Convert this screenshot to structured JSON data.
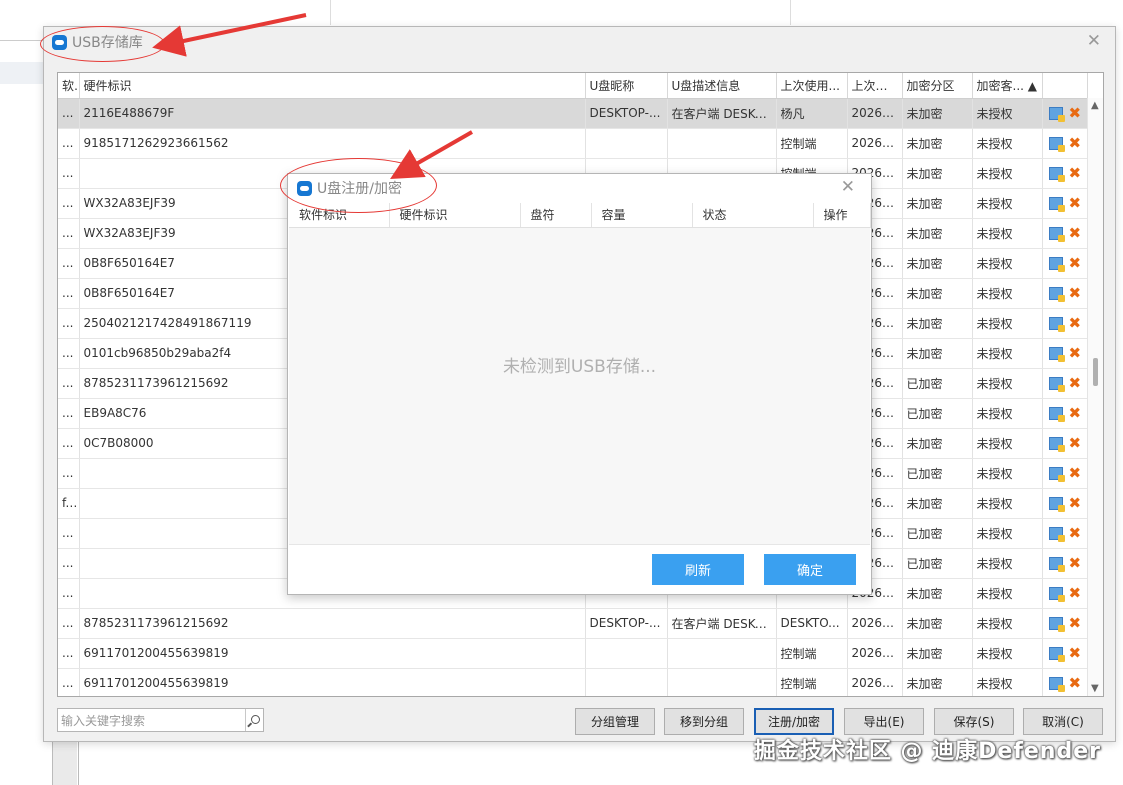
{
  "main_window": {
    "title": "USB存储库",
    "columns": [
      "软件标识",
      "硬件标识",
      "U盘昵称",
      "U盘描述信息",
      "上次使用...",
      "上次使...",
      "加密分区",
      "加密客... ▲",
      ""
    ],
    "rows": [
      {
        "c0": "...",
        "c1": "2116E488679F",
        "c2": "DESKTOP-...",
        "c3": "在客户端 DESKT...",
        "c4": "杨凡",
        "c5": "2026-...",
        "c6": "未加密",
        "c7": "未授权"
      },
      {
        "c0": "...",
        "c1": "9185171262923661562",
        "c2": "",
        "c3": "",
        "c4": "控制端",
        "c5": "2026-...",
        "c6": "未加密",
        "c7": "未授权"
      },
      {
        "c0": "...",
        "c1": "",
        "c2": "",
        "c3": "",
        "c4": "控制端",
        "c5": "2026-...",
        "c6": "未加密",
        "c7": "未授权"
      },
      {
        "c0": "...",
        "c1": "WX32A83EJF39",
        "c2": "",
        "c3": "",
        "c4": "",
        "c5": "2026-...",
        "c6": "未加密",
        "c7": "未授权"
      },
      {
        "c0": "...",
        "c1": "WX32A83EJF39",
        "c2": "",
        "c3": "",
        "c4": "",
        "c5": "2026-...",
        "c6": "未加密",
        "c7": "未授权"
      },
      {
        "c0": "...",
        "c1": "0B8F650164E7",
        "c2": "",
        "c3": "",
        "c4": "",
        "c5": "2026-...",
        "c6": "未加密",
        "c7": "未授权"
      },
      {
        "c0": "...",
        "c1": "0B8F650164E7",
        "c2": "",
        "c3": "",
        "c4": "",
        "c5": "2026-...",
        "c6": "未加密",
        "c7": "未授权"
      },
      {
        "c0": "...",
        "c1": "2504021217428491867119",
        "c2": "",
        "c3": "",
        "c4": "",
        "c5": "2026-...",
        "c6": "未加密",
        "c7": "未授权"
      },
      {
        "c0": "...",
        "c1": "0101cb96850b29aba2f4",
        "c2": "",
        "c3": "",
        "c4": "",
        "c5": "2026-...",
        "c6": "未加密",
        "c7": "未授权"
      },
      {
        "c0": "...",
        "c1": "8785231173961215692",
        "c2": "",
        "c3": "",
        "c4": "",
        "c5": "2026-...",
        "c6": "已加密",
        "c7": "未授权"
      },
      {
        "c0": "...",
        "c1": "EB9A8C76",
        "c2": "",
        "c3": "",
        "c4": "",
        "c5": "2026-...",
        "c6": "已加密",
        "c7": "未授权"
      },
      {
        "c0": "...",
        "c1": "0C7B08000",
        "c2": "",
        "c3": "",
        "c4": "",
        "c5": "2026-...",
        "c6": "未加密",
        "c7": "未授权"
      },
      {
        "c0": "...",
        "c1": "",
        "c2": "",
        "c3": "",
        "c4": "",
        "c5": "2026-...",
        "c6": "已加密",
        "c7": "未授权"
      },
      {
        "c0": "f...",
        "c1": "",
        "c2": "",
        "c3": "",
        "c4": "",
        "c5": "2026-...",
        "c6": "未加密",
        "c7": "未授权"
      },
      {
        "c0": "...",
        "c1": "",
        "c2": "",
        "c3": "",
        "c4": "",
        "c5": "2026-...",
        "c6": "已加密",
        "c7": "未授权"
      },
      {
        "c0": "...",
        "c1": "",
        "c2": "",
        "c3": "",
        "c4": "",
        "c5": "2026-...",
        "c6": "已加密",
        "c7": "未授权"
      },
      {
        "c0": "...",
        "c1": "",
        "c2": "",
        "c3": "",
        "c4": "",
        "c5": "2026-...",
        "c6": "未加密",
        "c7": "未授权"
      },
      {
        "c0": "...",
        "c1": "8785231173961215692",
        "c2": "DESKTOP-...",
        "c3": "在客户端 DESKT...",
        "c4": "DESKTO...",
        "c5": "2026-...",
        "c6": "未加密",
        "c7": "未授权"
      },
      {
        "c0": "...",
        "c1": "6911701200455639819",
        "c2": "",
        "c3": "",
        "c4": "控制端",
        "c5": "2026-...",
        "c6": "未加密",
        "c7": "未授权"
      },
      {
        "c0": "...",
        "c1": "6911701200455639819",
        "c2": "",
        "c3": "",
        "c4": "控制端",
        "c5": "2026-...",
        "c6": "未加密",
        "c7": "未授权"
      }
    ],
    "search_placeholder": "输入关键字搜索",
    "buttons": {
      "group_manage": "分组管理",
      "move_group": "移到分组",
      "register": "注册/加密",
      "export": "导出(E)",
      "save": "保存(S)",
      "cancel": "取消(C)"
    }
  },
  "register_dialog": {
    "title": "U盘注册/加密",
    "columns": [
      "软件标识",
      "硬件标识",
      "盘符",
      "容量",
      "状态",
      "操作"
    ],
    "empty_text": "未检测到USB存储...",
    "refresh": "刷新",
    "confirm": "确定"
  },
  "watermark": "掘金技术社区 @ 迪康Defender",
  "colors": {
    "accent": "#3aa0f0",
    "annotation": "#e53935",
    "delete": "#e86a12",
    "selected_row": "#d9d9d9"
  }
}
